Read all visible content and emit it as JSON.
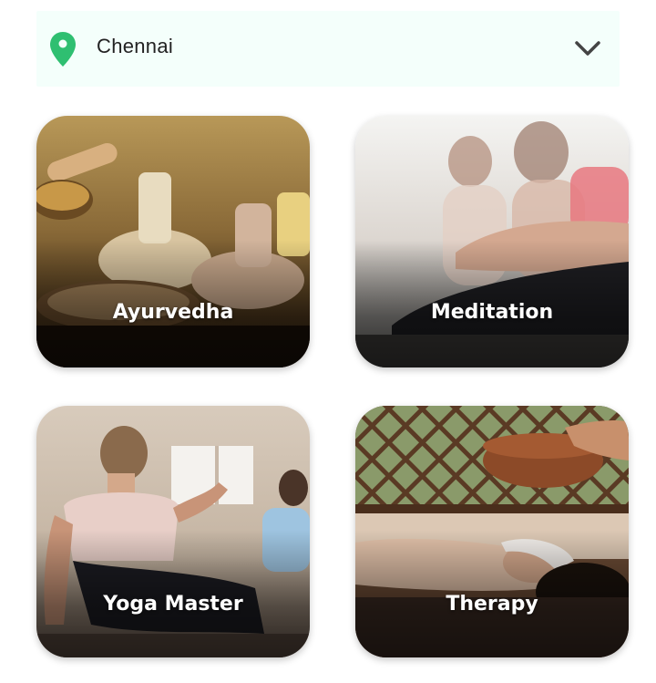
{
  "location": {
    "city": "Chennai",
    "pin_icon": "map-pin-icon",
    "dropdown_icon": "chevron-down-icon",
    "pin_color": "#2fbf71"
  },
  "categories": [
    {
      "label": "Ayurvedha"
    },
    {
      "label": "Meditation"
    },
    {
      "label": "Yoga Master"
    },
    {
      "label": "Therapy"
    }
  ]
}
